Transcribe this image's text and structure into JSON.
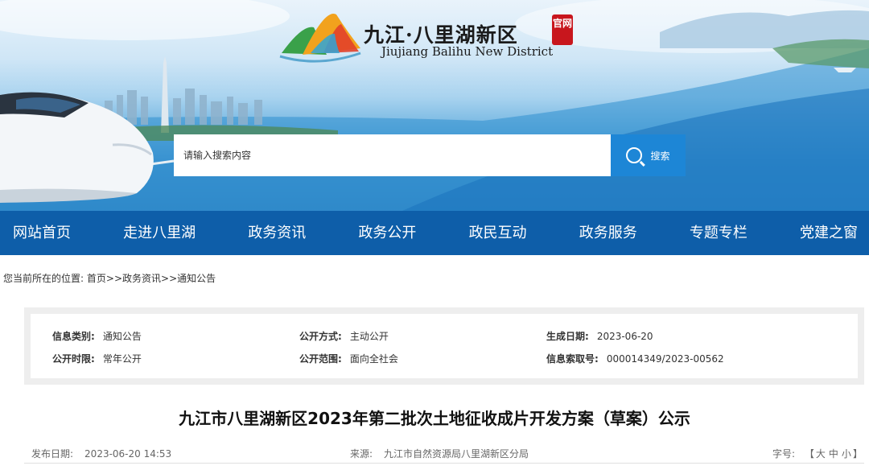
{
  "site": {
    "name_cn": "九江·八里湖新区",
    "name_en": "Jiujiang Balihu New District",
    "seal": "官网"
  },
  "search": {
    "placeholder": "请输入搜索内容",
    "button_label": "搜索"
  },
  "nav": {
    "items": [
      "网站首页",
      "走进八里湖",
      "政务资讯",
      "政务公开",
      "政民互动",
      "政务服务",
      "专题专栏",
      "党建之窗"
    ]
  },
  "breadcrumb": {
    "prefix": "您当前所在的位置:",
    "items": [
      "首页",
      "政务资讯",
      "通知公告"
    ],
    "separator": ">>"
  },
  "info": {
    "category_label": "信息类别:",
    "category_value": "通知公告",
    "duration_label": "公开时限:",
    "duration_value": "常年公开",
    "method_label": "公开方式:",
    "method_value": "主动公开",
    "scope_label": "公开范围:",
    "scope_value": "面向全社会",
    "date_label": "生成日期:",
    "date_value": "2023-06-20",
    "index_label": "信息索取号:",
    "index_value": "000014349/2023-00562"
  },
  "article": {
    "title": "九江市八里湖新区2023年第二批次土地征收成片开发方案（草案）公示",
    "publish_label": "发布日期:",
    "publish_value": "2023-06-20 14:53",
    "source_label": "来源:",
    "source_value": "九江市自然资源局八里湖新区分局",
    "fontsize_label": "字号:",
    "fontsize_open": "【",
    "fontsize_options": [
      "大",
      "中",
      "小"
    ],
    "fontsize_close": "】"
  },
  "colors": {
    "nav_bg": "#0e5ea9",
    "search_btn": "#1d86d6",
    "seal": "#c8161d"
  }
}
